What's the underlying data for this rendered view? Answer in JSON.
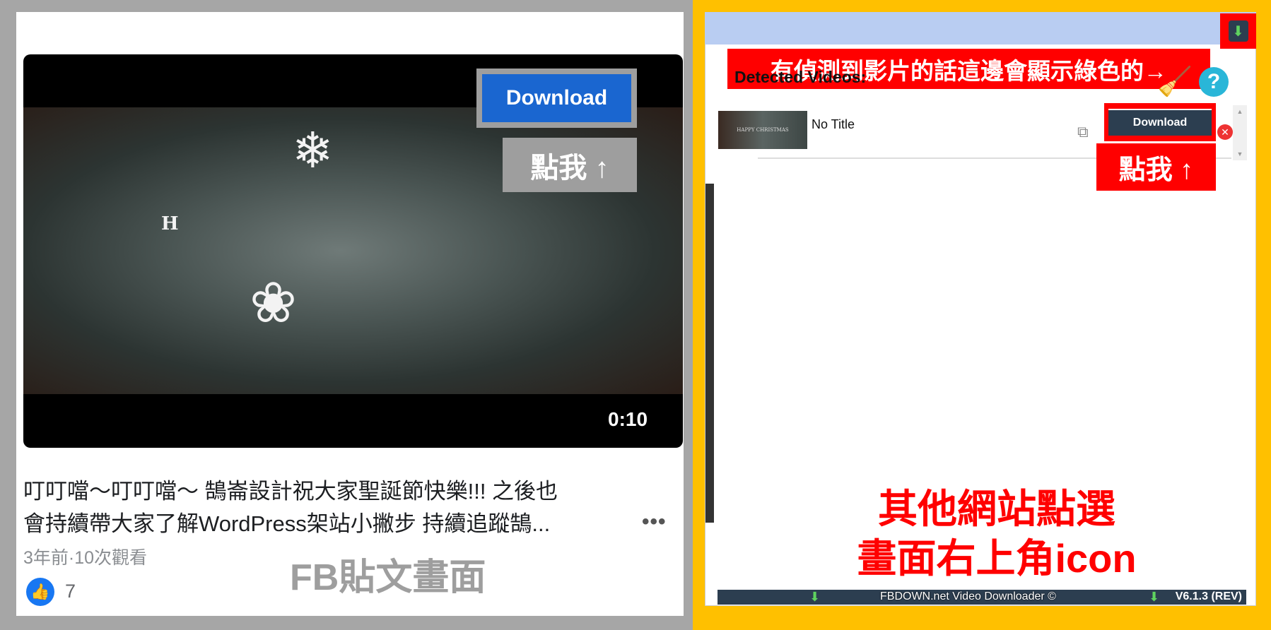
{
  "fb": {
    "download_label": "Download",
    "click_me": "點我 ↑",
    "duration": "0:10",
    "video_overlay_letter": "H",
    "caption_line1": "叮叮噹～叮叮噹～ 鵠崙設計祝大家聖誕節快樂!!! 之後也",
    "caption_line2": "會持續帶大家了解WordPress架站小撇步 持續追蹤鵠...",
    "more": "•••",
    "meta": "3年前·10次觀看",
    "like_count": "7",
    "label": "FB貼文畫面"
  },
  "ext": {
    "banner": "有偵測到影片的話這邊會顯示綠色的→",
    "title": "Detected Videos:",
    "video": {
      "thumb_text": "HAPPY CHRISTMAS",
      "title": "No Title",
      "download_label": "Download"
    },
    "click_me": "點我 ↑",
    "note_line1": "其他網站點選",
    "note_line2": "畫面右上角icon",
    "footer": "FBDOWN.net Video Downloader ©",
    "version": "V6.1.3 (REV)"
  },
  "colors": {
    "fb_blue": "#1a66d0",
    "highlight_red": "#ff0000",
    "frame_yellow": "#ffc000",
    "ext_dark": "#2c3e50"
  }
}
